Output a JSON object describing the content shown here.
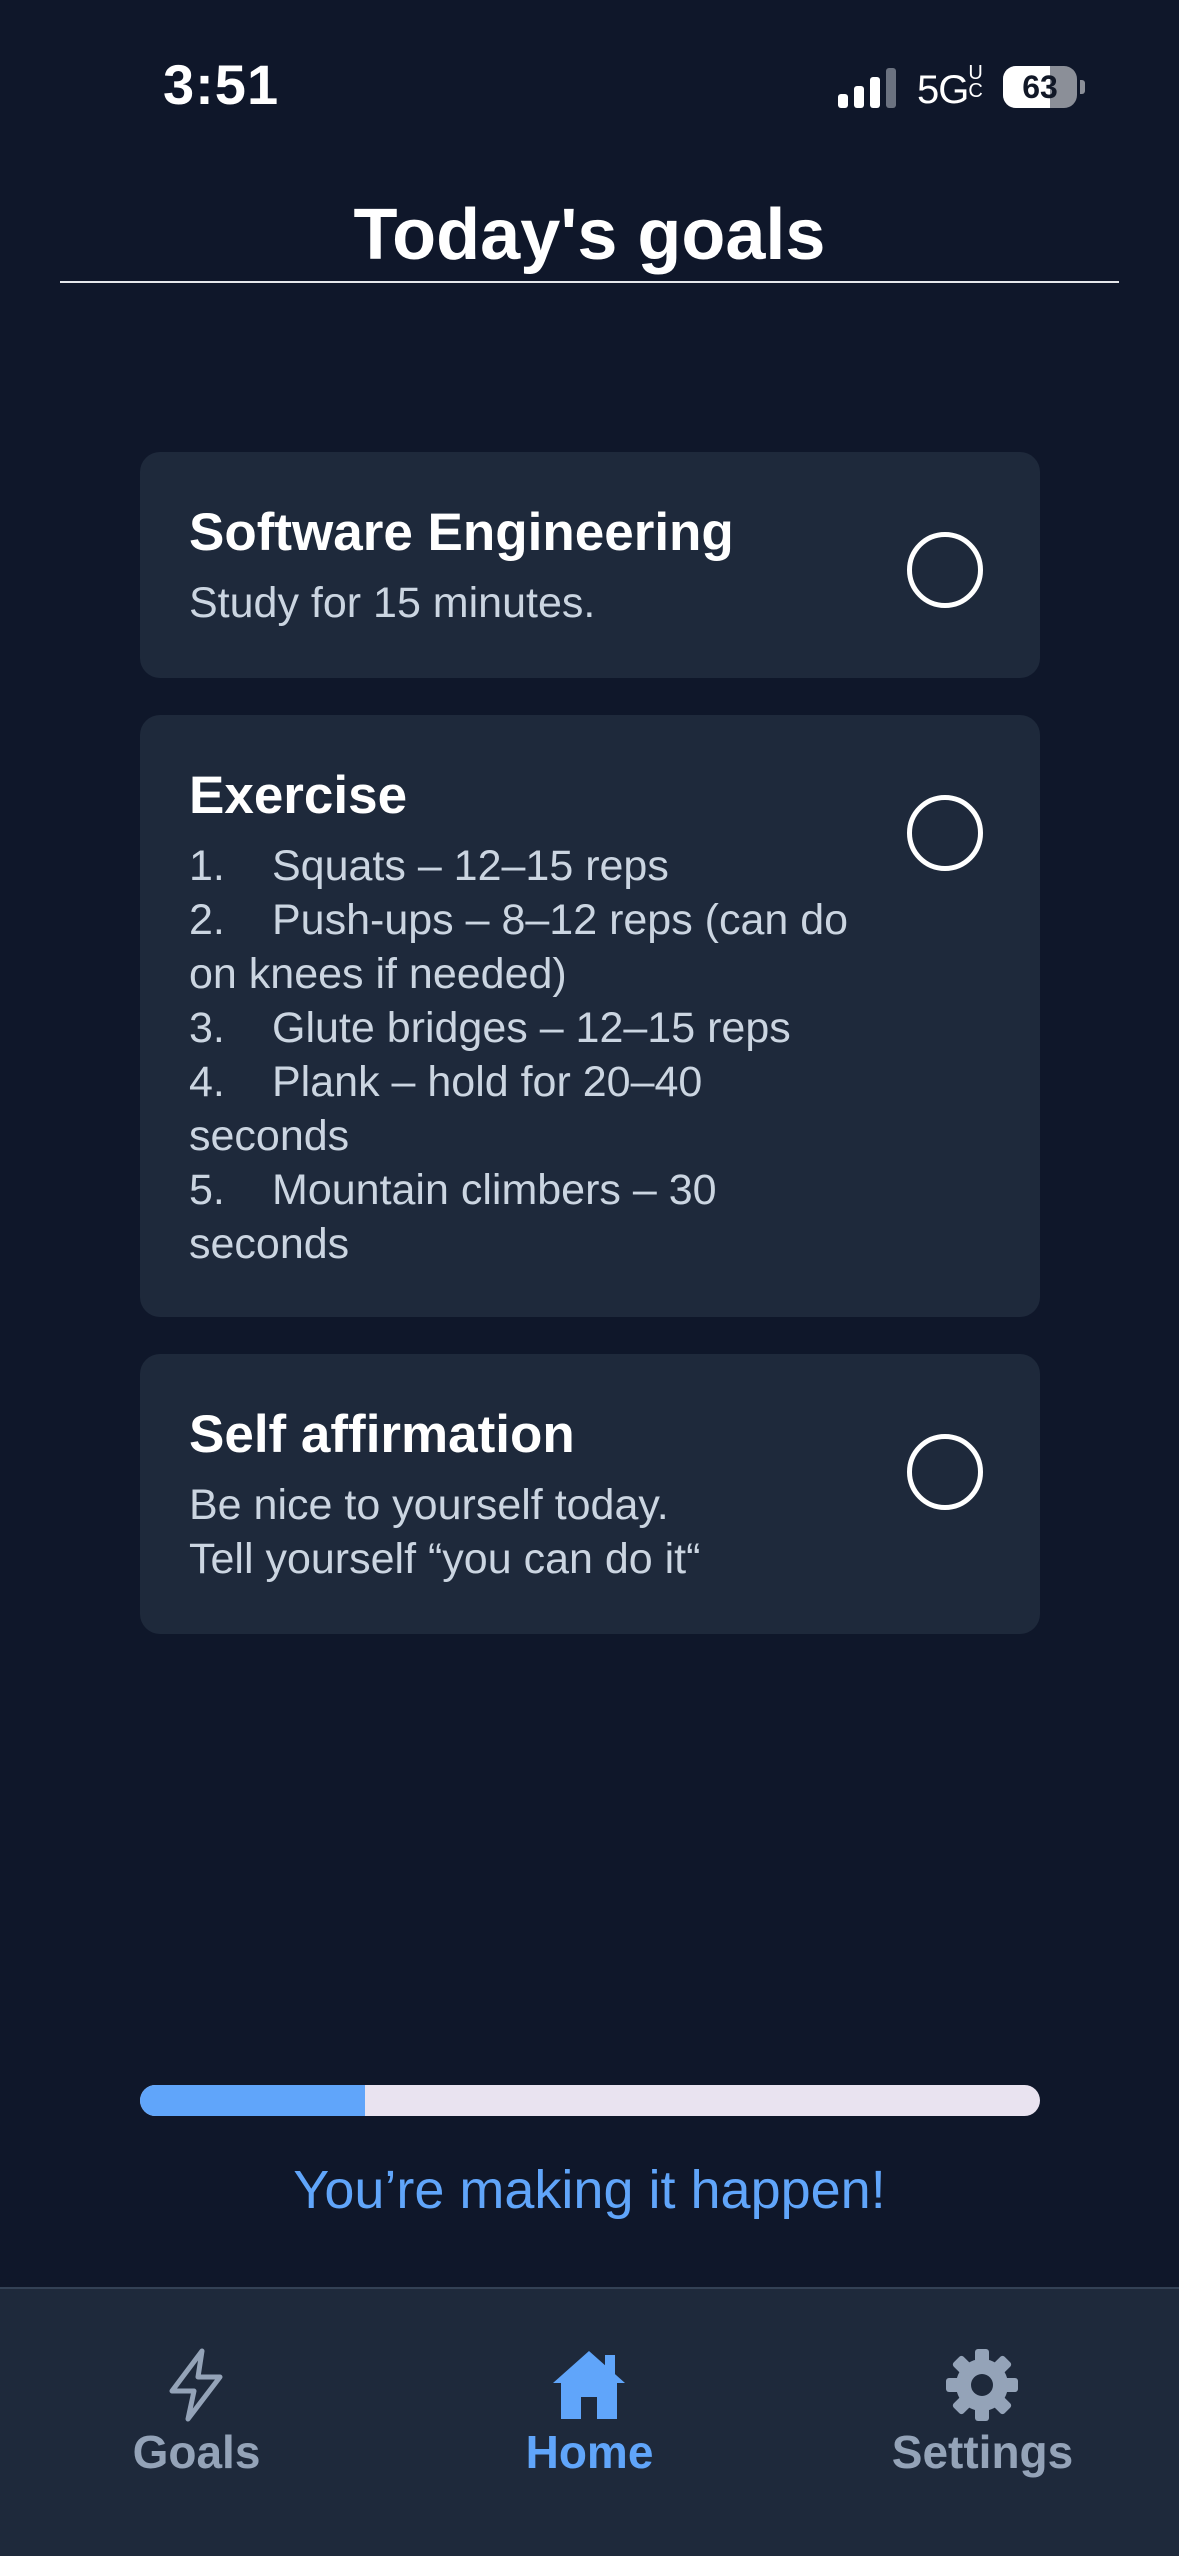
{
  "status_bar": {
    "time": "3:51",
    "network": "5G",
    "network_suffix": "UC",
    "battery_level": "63",
    "battery_fraction": 0.63
  },
  "header": {
    "title": "Today's goals"
  },
  "goals": [
    {
      "title": "Software Engineering",
      "lines": [
        "Study for 15 minutes."
      ],
      "completed": false
    },
    {
      "title": "Exercise",
      "steps": [
        {
          "num": "1.",
          "text": "Squats – 12–15 reps"
        },
        {
          "num": "2.",
          "text": "Push-ups – 8–12 reps (can do",
          "cont": "on knees if needed)"
        },
        {
          "num": "3.",
          "text": "Glute bridges – 12–15 reps"
        },
        {
          "num": "4.",
          "text": "Plank – hold for 20–40",
          "cont": "seconds"
        },
        {
          "num": "5.",
          "text": "Mountain climbers – 30",
          "cont": "seconds"
        }
      ],
      "completed": false
    },
    {
      "title": "Self affirmation",
      "lines": [
        "Be nice to yourself today.",
        "Tell yourself “you can do it“"
      ],
      "completed": false
    }
  ],
  "progress": {
    "fraction": 0.25,
    "message": "You’re making it happen!"
  },
  "nav": {
    "items": [
      {
        "label": "Goals",
        "icon": "lightning-icon",
        "active": false
      },
      {
        "label": "Home",
        "icon": "home-icon",
        "active": true
      },
      {
        "label": "Settings",
        "icon": "gear-icon",
        "active": false
      }
    ]
  },
  "colors": {
    "background": "#0f172a",
    "card": "#1e293b",
    "accent": "#60a5fa",
    "muted": "#94a3b8"
  }
}
